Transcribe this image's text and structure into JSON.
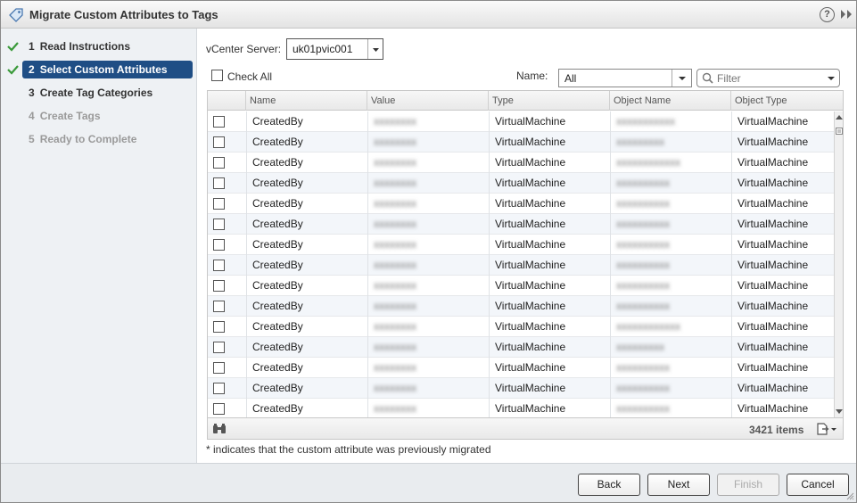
{
  "window": {
    "title": "Migrate Custom Attributes to Tags",
    "help_glyph": "?"
  },
  "steps": [
    {
      "num": "1",
      "label": "Read Instructions",
      "state": "done"
    },
    {
      "num": "2",
      "label": "Select Custom Attributes",
      "state": "active"
    },
    {
      "num": "3",
      "label": "Create Tag Categories",
      "state": "current"
    },
    {
      "num": "4",
      "label": "Create Tags",
      "state": "disabled"
    },
    {
      "num": "5",
      "label": "Ready to Complete",
      "state": "disabled"
    }
  ],
  "vcenter": {
    "label": "vCenter Server:",
    "value": "uk01pvic001"
  },
  "check_all_label": "Check All",
  "name_filter": {
    "label": "Name:",
    "value": "All"
  },
  "filter": {
    "placeholder": "Filter"
  },
  "table": {
    "columns": [
      "Name",
      "Value",
      "Type",
      "Object Name",
      "Object Type"
    ],
    "rows": [
      {
        "name": "CreatedBy",
        "value": "xxxxxxxx",
        "type": "VirtualMachine",
        "object_name": "xxxxxxxxxxx",
        "object_type": "VirtualMachine"
      },
      {
        "name": "CreatedBy",
        "value": "xxxxxxxx",
        "type": "VirtualMachine",
        "object_name": "xxxxxxxxx",
        "object_type": "VirtualMachine"
      },
      {
        "name": "CreatedBy",
        "value": "xxxxxxxx",
        "type": "VirtualMachine",
        "object_name": "xxxxxxxxxxxx",
        "object_type": "VirtualMachine"
      },
      {
        "name": "CreatedBy",
        "value": "xxxxxxxx",
        "type": "VirtualMachine",
        "object_name": "xxxxxxxxxx",
        "object_type": "VirtualMachine"
      },
      {
        "name": "CreatedBy",
        "value": "xxxxxxxx",
        "type": "VirtualMachine",
        "object_name": "xxxxxxxxxx",
        "object_type": "VirtualMachine"
      },
      {
        "name": "CreatedBy",
        "value": "xxxxxxxx",
        "type": "VirtualMachine",
        "object_name": "xxxxxxxxxx",
        "object_type": "VirtualMachine"
      },
      {
        "name": "CreatedBy",
        "value": "xxxxxxxx",
        "type": "VirtualMachine",
        "object_name": "xxxxxxxxxx",
        "object_type": "VirtualMachine"
      },
      {
        "name": "CreatedBy",
        "value": "xxxxxxxx",
        "type": "VirtualMachine",
        "object_name": "xxxxxxxxxx",
        "object_type": "VirtualMachine"
      },
      {
        "name": "CreatedBy",
        "value": "xxxxxxxx",
        "type": "VirtualMachine",
        "object_name": "xxxxxxxxxx",
        "object_type": "VirtualMachine"
      },
      {
        "name": "CreatedBy",
        "value": "xxxxxxxx",
        "type": "VirtualMachine",
        "object_name": "xxxxxxxxxx",
        "object_type": "VirtualMachine"
      },
      {
        "name": "CreatedBy",
        "value": "xxxxxxxx",
        "type": "VirtualMachine",
        "object_name": "xxxxxxxxxxxx",
        "object_type": "VirtualMachine"
      },
      {
        "name": "CreatedBy",
        "value": "xxxxxxxx",
        "type": "VirtualMachine",
        "object_name": "xxxxxxxxx",
        "object_type": "VirtualMachine"
      },
      {
        "name": "CreatedBy",
        "value": "xxxxxxxx",
        "type": "VirtualMachine",
        "object_name": "xxxxxxxxxx",
        "object_type": "VirtualMachine"
      },
      {
        "name": "CreatedBy",
        "value": "xxxxxxxx",
        "type": "VirtualMachine",
        "object_name": "xxxxxxxxxx",
        "object_type": "VirtualMachine"
      },
      {
        "name": "CreatedBy",
        "value": "xxxxxxxx",
        "type": "VirtualMachine",
        "object_name": "xxxxxxxxxx",
        "object_type": "VirtualMachine"
      }
    ],
    "items_count": "3421 items"
  },
  "footnote": "* indicates that the custom attribute was previously migrated",
  "buttons": {
    "back": "Back",
    "next": "Next",
    "finish": "Finish",
    "cancel": "Cancel"
  },
  "colors": {
    "active_step": "#1f4e85",
    "check": "#3a9a3a"
  }
}
